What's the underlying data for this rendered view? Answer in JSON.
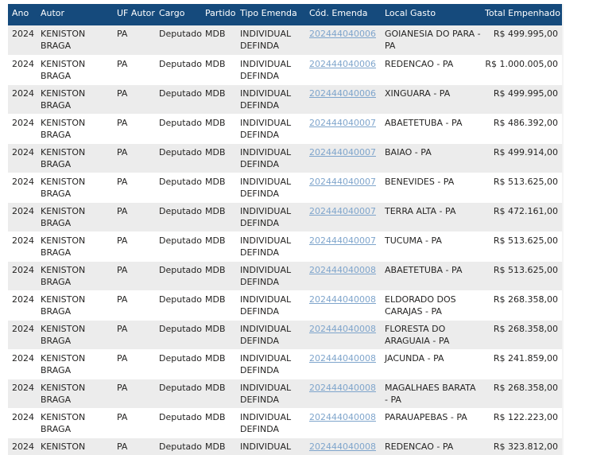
{
  "columns": [
    "Ano",
    "Autor",
    "UF Autor",
    "Cargo",
    "Partido",
    "Tipo Emenda",
    "Cód. Emenda",
    "Local Gasto",
    "Total Empenhado"
  ],
  "rows": [
    [
      "2024",
      "KENISTON BRAGA",
      "PA",
      "Deputado",
      "MDB",
      "INDIVIDUAL DEFINDA",
      "202444040006",
      "GOIANESIA DO PARA - PA",
      "R$ 499.995,00"
    ],
    [
      "2024",
      "KENISTON BRAGA",
      "PA",
      "Deputado",
      "MDB",
      "INDIVIDUAL DEFINDA",
      "202444040006",
      "REDENCAO - PA",
      "R$ 1.000.005,00"
    ],
    [
      "2024",
      "KENISTON BRAGA",
      "PA",
      "Deputado",
      "MDB",
      "INDIVIDUAL DEFINDA",
      "202444040006",
      "XINGUARA - PA",
      "R$ 499.995,00"
    ],
    [
      "2024",
      "KENISTON BRAGA",
      "PA",
      "Deputado",
      "MDB",
      "INDIVIDUAL DEFINDA",
      "202444040007",
      "ABAETETUBA - PA",
      "R$ 486.392,00"
    ],
    [
      "2024",
      "KENISTON BRAGA",
      "PA",
      "Deputado",
      "MDB",
      "INDIVIDUAL DEFINDA",
      "202444040007",
      "BAIAO - PA",
      "R$ 499.914,00"
    ],
    [
      "2024",
      "KENISTON BRAGA",
      "PA",
      "Deputado",
      "MDB",
      "INDIVIDUAL DEFINDA",
      "202444040007",
      "BENEVIDES - PA",
      "R$ 513.625,00"
    ],
    [
      "2024",
      "KENISTON BRAGA",
      "PA",
      "Deputado",
      "MDB",
      "INDIVIDUAL DEFINDA",
      "202444040007",
      "TERRA ALTA - PA",
      "R$ 472.161,00"
    ],
    [
      "2024",
      "KENISTON BRAGA",
      "PA",
      "Deputado",
      "MDB",
      "INDIVIDUAL DEFINDA",
      "202444040007",
      "TUCUMA - PA",
      "R$ 513.625,00"
    ],
    [
      "2024",
      "KENISTON BRAGA",
      "PA",
      "Deputado",
      "MDB",
      "INDIVIDUAL DEFINDA",
      "202444040008",
      "ABAETETUBA - PA",
      "R$ 513.625,00"
    ],
    [
      "2024",
      "KENISTON BRAGA",
      "PA",
      "Deputado",
      "MDB",
      "INDIVIDUAL DEFINDA",
      "202444040008",
      "ELDORADO DOS CARAJAS - PA",
      "R$ 268.358,00"
    ],
    [
      "2024",
      "KENISTON BRAGA",
      "PA",
      "Deputado",
      "MDB",
      "INDIVIDUAL DEFINDA",
      "202444040008",
      "FLORESTA DO ARAGUAIA - PA",
      "R$ 268.358,00"
    ],
    [
      "2024",
      "KENISTON BRAGA",
      "PA",
      "Deputado",
      "MDB",
      "INDIVIDUAL DEFINDA",
      "202444040008",
      "JACUNDA - PA",
      "R$ 241.859,00"
    ],
    [
      "2024",
      "KENISTON BRAGA",
      "PA",
      "Deputado",
      "MDB",
      "INDIVIDUAL DEFINDA",
      "202444040008",
      "MAGALHAES BARATA - PA",
      "R$ 268.358,00"
    ],
    [
      "2024",
      "KENISTON BRAGA",
      "PA",
      "Deputado",
      "MDB",
      "INDIVIDUAL DEFINDA",
      "202444040008",
      "PARAUAPEBAS - PA",
      "R$ 122.223,00"
    ],
    [
      "2024",
      "KENISTON BRAGA",
      "PA",
      "Deputado",
      "MDB",
      "INDIVIDUAL DEFINDA",
      "202444040008",
      "REDENCAO - PA",
      "R$ 323.812,00"
    ]
  ]
}
